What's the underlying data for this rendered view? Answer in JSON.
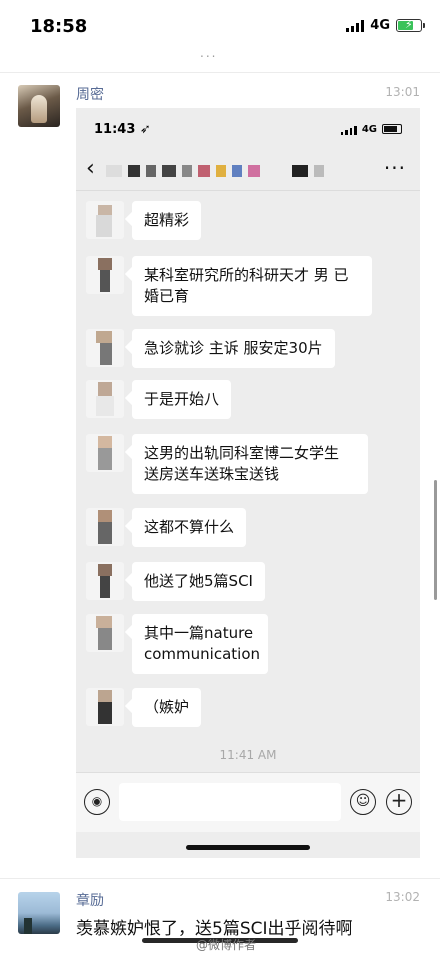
{
  "status_bar": {
    "time": "18:58",
    "network": "4G"
  },
  "moments_tip": "...",
  "comments": [
    {
      "name": "周密",
      "time": "13:01"
    },
    {
      "name": "章励",
      "time": "13:02",
      "text": "羡慕嫉妒恨了，送5篇SCI出乎阅待啊"
    }
  ],
  "screenshot": {
    "status_time": "11:43",
    "status_network": "4G",
    "messages": [
      "超精彩",
      "某科室研究所的科研天才 男 已婚已育",
      "急诊就诊 主诉 服安定30片",
      "于是开始八",
      "这男的出轨同科室博二女学生 送房送车送珠宝送钱",
      "这都不算什么",
      "他送了她5篇SCI",
      "其中一篇nature communication",
      "（嫉妒"
    ],
    "chat_time": "11:41 AM"
  },
  "watermark": "@微博作者",
  "icons": {
    "back": "chevron-left-icon",
    "more": "more-icon",
    "voice": "voice-icon",
    "emoji": "emoji-icon",
    "plus": "plus-icon"
  },
  "colors": {
    "name": "#576b95",
    "chat_bg": "#ededed",
    "bubble": "#ffffff",
    "battery": "#3ac25a"
  }
}
